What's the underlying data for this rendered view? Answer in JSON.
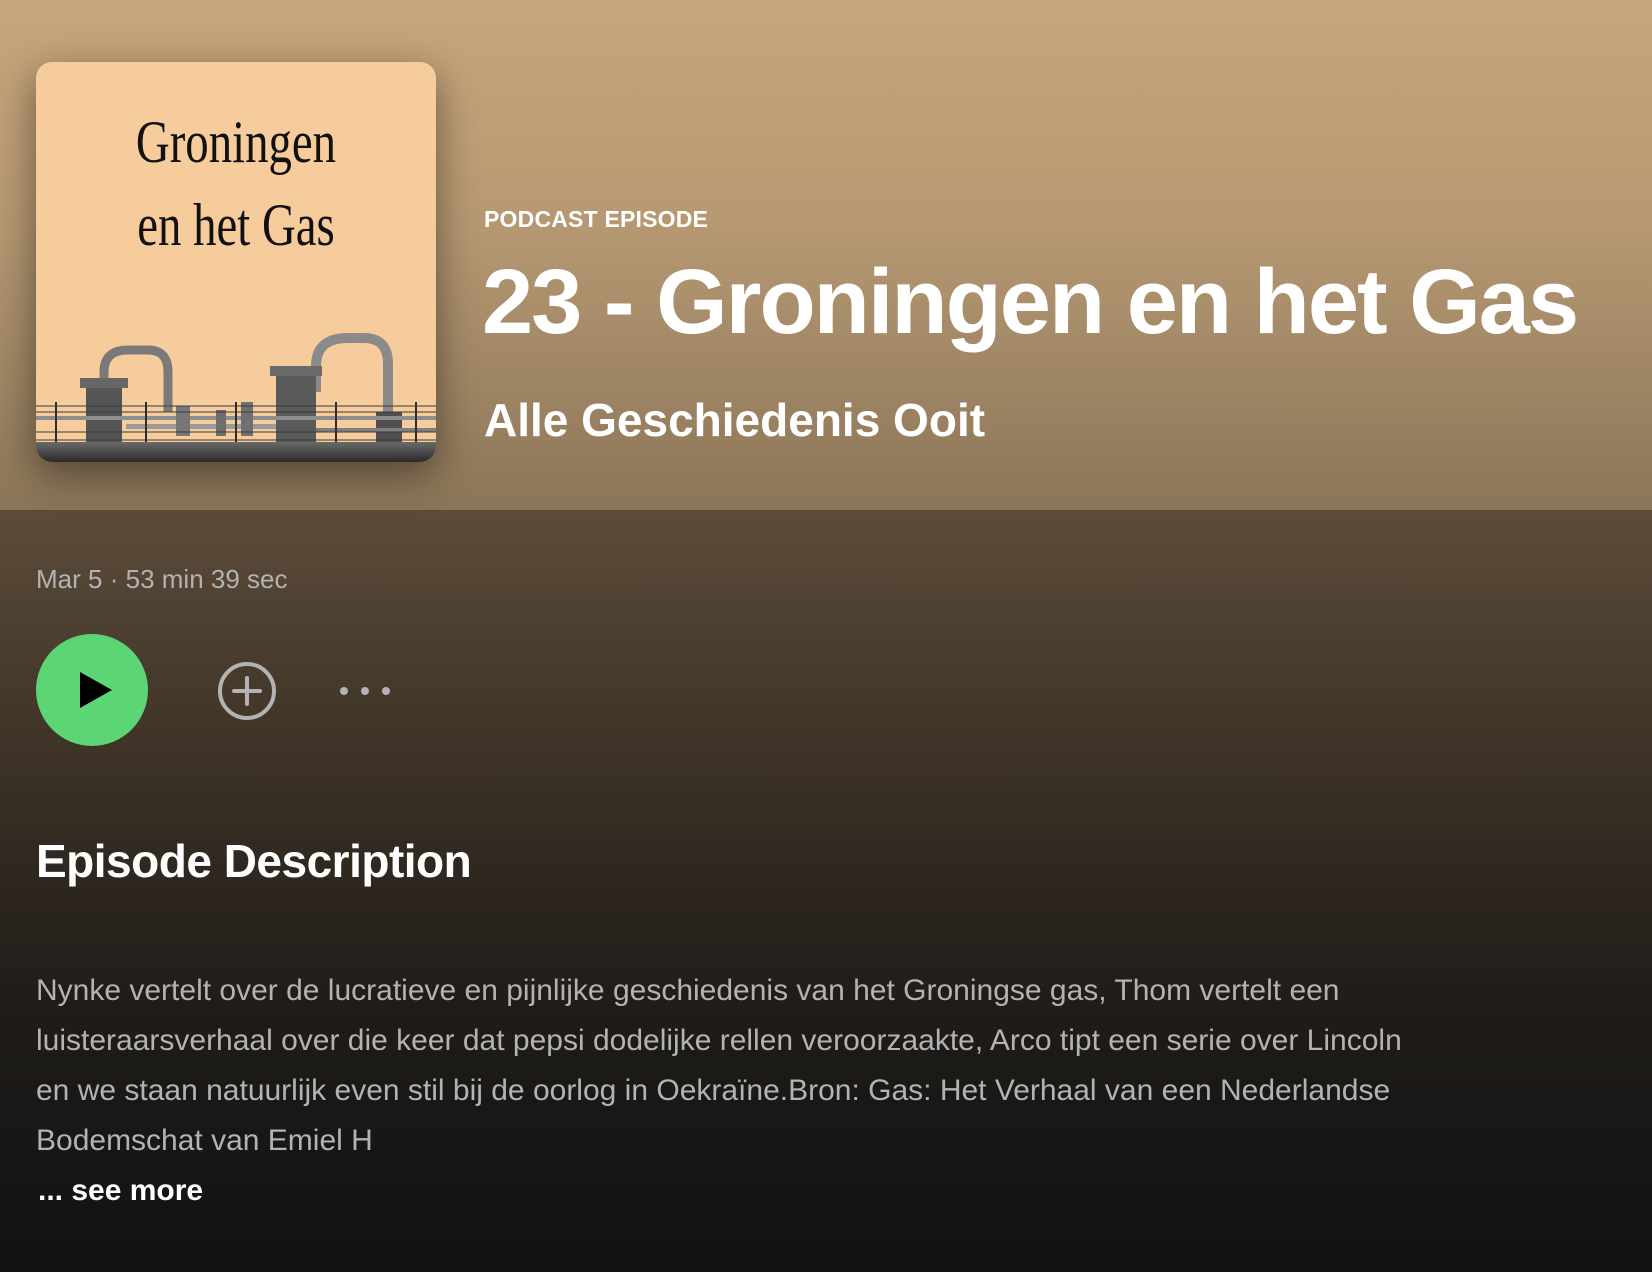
{
  "cover": {
    "title_line1": "Groningen",
    "title_line2": "en het Gas",
    "background_color": "#f7cc9c"
  },
  "header": {
    "type_label": "PODCAST EPISODE",
    "title": "23 - Groningen en het Gas",
    "show_name": "Alle Geschiedenis Ooit"
  },
  "meta": {
    "date": "Mar 5",
    "separator": "·",
    "duration": "53 min 39 sec"
  },
  "actions": {
    "play_icon": "play-icon",
    "add_icon": "plus-circle-icon",
    "more_icon": "more-horizontal-icon",
    "play_color": "#5cd675"
  },
  "description": {
    "heading": "Episode Description",
    "text": "Nynke vertelt over de lucratieve en pijnlijke geschiedenis van het Groningse gas, Thom vertelt een luisteraarsverhaal over die keer dat pepsi dodelijke rellen veroorzaakte, Arco tipt een serie over Lincoln en we staan natuurlijk even stil bij de oorlog in Oekraïne.Bron: Gas: Het Verhaal van een Nederlandse Bodemschat van Emiel H",
    "see_more": "... see more"
  }
}
